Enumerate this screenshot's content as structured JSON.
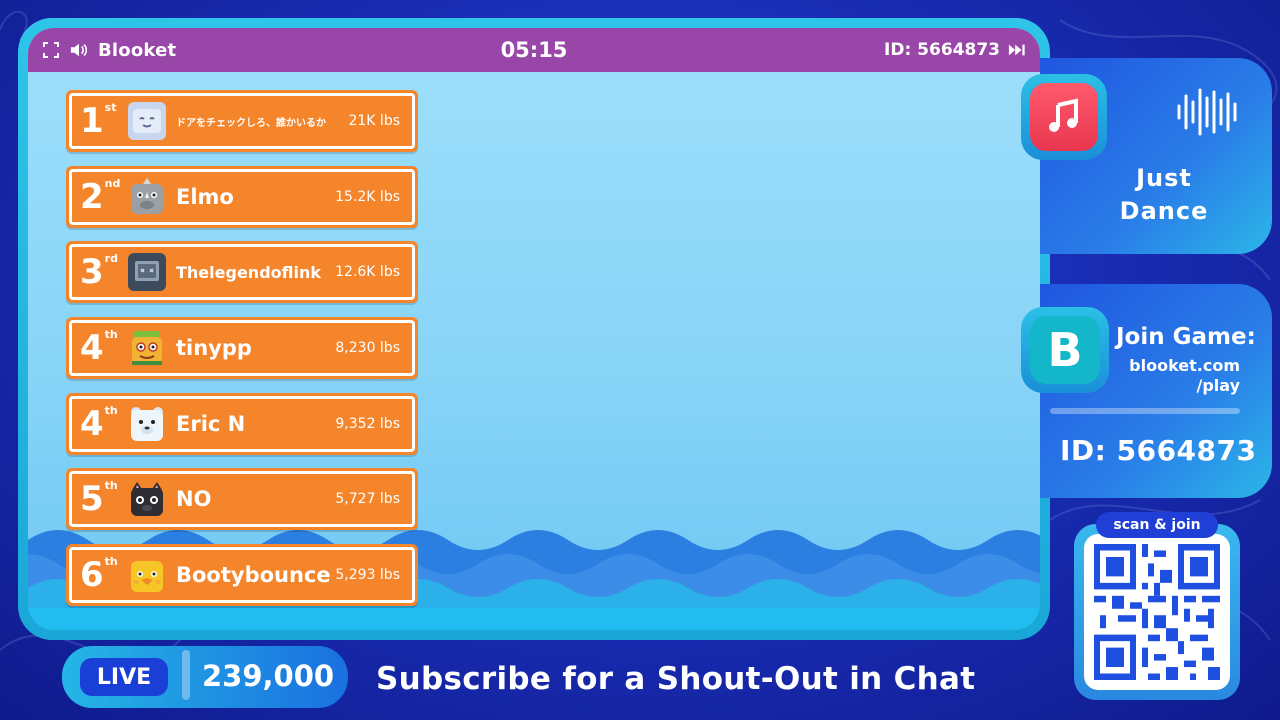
{
  "game": {
    "brand": "Blooket",
    "timer": "05:15",
    "game_id": "ID: 5664873",
    "fullscreen_icon": "fullscreen-icon",
    "sound_icon": "speaker-icon",
    "skip_icon": "fast-forward-icon"
  },
  "leaderboard": [
    {
      "place": "1",
      "suffix": "st",
      "name": "ドアをチェックしろ、誰かいるか",
      "score": "21K lbs",
      "avatar": "ghost",
      "avatar_color": "#c8d6f0"
    },
    {
      "place": "2",
      "suffix": "nd",
      "name": "Elmo",
      "score": "15.2K lbs",
      "avatar": "rhino",
      "avatar_color": "#9aa0a6"
    },
    {
      "place": "3",
      "suffix": "rd",
      "name": "Thelegendoflink",
      "score": "12.6K lbs",
      "avatar": "robot",
      "avatar_color": "#3d4a5c"
    },
    {
      "place": "4",
      "suffix": "th",
      "name": "tinypp",
      "score": "8,230 lbs",
      "avatar": "explorer",
      "avatar_color": "#f2b233"
    },
    {
      "place": "4",
      "suffix": "th",
      "name": "Eric N",
      "score": "9,352 lbs",
      "avatar": "polar-bear",
      "avatar_color": "#e8f2fa"
    },
    {
      "place": "5",
      "suffix": "th",
      "name": "NO",
      "score": "5,727 lbs",
      "avatar": "black-cat",
      "avatar_color": "#2d2d33"
    },
    {
      "place": "6",
      "suffix": "th",
      "name": "Bootybounce",
      "score": "5,293 lbs",
      "avatar": "chick",
      "avatar_color": "#f6c526"
    }
  ],
  "music": {
    "title_line1": "Just",
    "title_line2": "Dance",
    "icon": "music-note-icon"
  },
  "join": {
    "title": "Join Game:",
    "url_line1": "blooket.com",
    "url_line2": "/play",
    "game_id": "ID: 5664873",
    "icon_letter": "B"
  },
  "qr": {
    "label": "scan & join"
  },
  "stream": {
    "live_label": "LIVE",
    "viewer_count": "239,000",
    "subscribe_text": "Subscribe for a Shout-Out in Chat"
  },
  "colors": {
    "row_orange": "#f5852b",
    "topbar_purple": "#9847a8",
    "frame_cyan": "#2ec5e9",
    "background_blue": "#1a2fb8"
  }
}
